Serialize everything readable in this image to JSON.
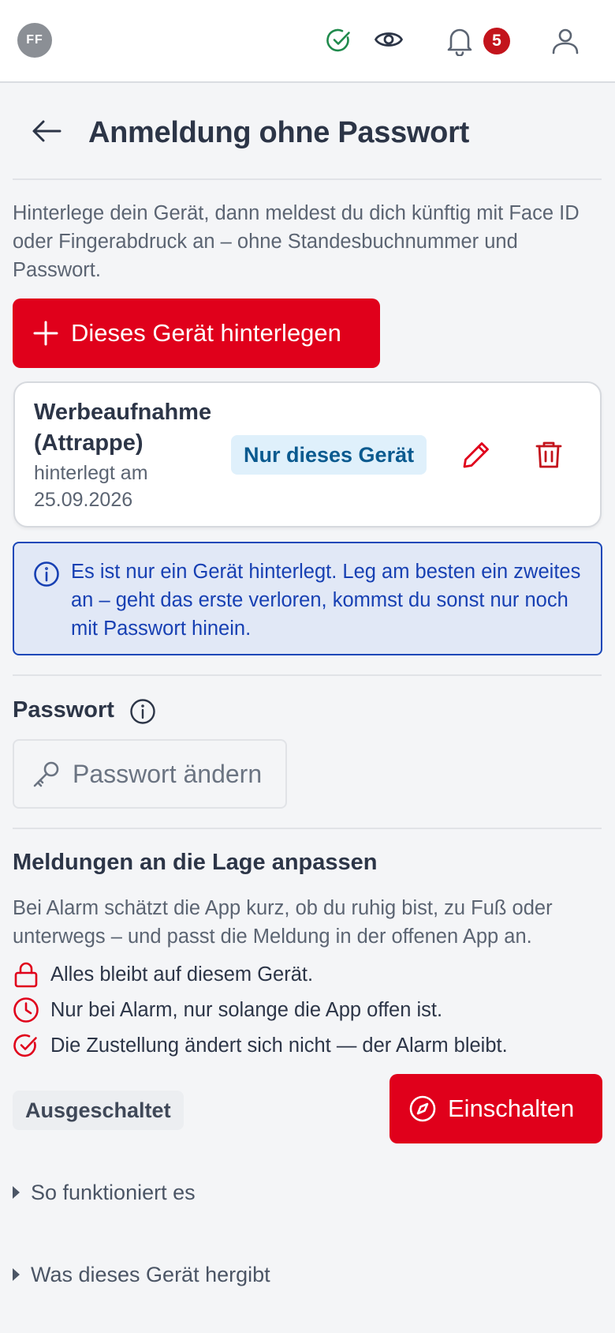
{
  "topbar": {
    "avatar_initials": "FF",
    "icons": [
      "check-circle-icon",
      "eye-icon",
      "bell-icon",
      "user-icon"
    ],
    "notification_count": "5"
  },
  "header": {
    "title": "Anmeldung ohne Passwort"
  },
  "intro": "Hinterlege dein Gerät, dann meldest du dich künftig mit Face ID oder Fingerabdruck an – ohne Standesbuchnummer und Passwort.",
  "add_device_button": "Dieses Gerät hinterlegen",
  "device": {
    "name": "Werbeaufnahme (Attrappe)",
    "registered": "hinterlegt am 25.09.2026",
    "chip": "Nur dieses Gerät"
  },
  "info_box": "Es ist nur ein Gerät hinterlegt. Leg am besten ein zweites an – geht das erste verloren, kommst du sonst nur noch mit Passwort hinein.",
  "password": {
    "heading": "Passwort",
    "change_button": "Passwort ändern"
  },
  "lage": {
    "heading": "Meldungen an die Lage anpassen",
    "description": "Bei Alarm schätzt die App kurz, ob du ruhig bist, zu Fuß oder unterwegs – und passt die Meldung in der offenen App an.",
    "bullets": [
      {
        "icon": "lock-icon",
        "text": "Alles bleibt auf diesem Gerät."
      },
      {
        "icon": "clock-icon",
        "text": "Nur bei Alarm, nur solange die App offen ist."
      },
      {
        "icon": "check-circle-icon",
        "text": "Die Zustellung ändert sich nicht — der Alarm bleibt."
      }
    ],
    "status": "Ausgeschaltet",
    "enable_button": "Einschalten"
  },
  "details": [
    "So funktioniert es",
    "Was dieses Gerät hergibt"
  ],
  "colors": {
    "primary_red": "#e0001b",
    "info_blue": "#1740b3",
    "chip_bg": "#dff0fb",
    "success_green": "#1f8a4c"
  }
}
